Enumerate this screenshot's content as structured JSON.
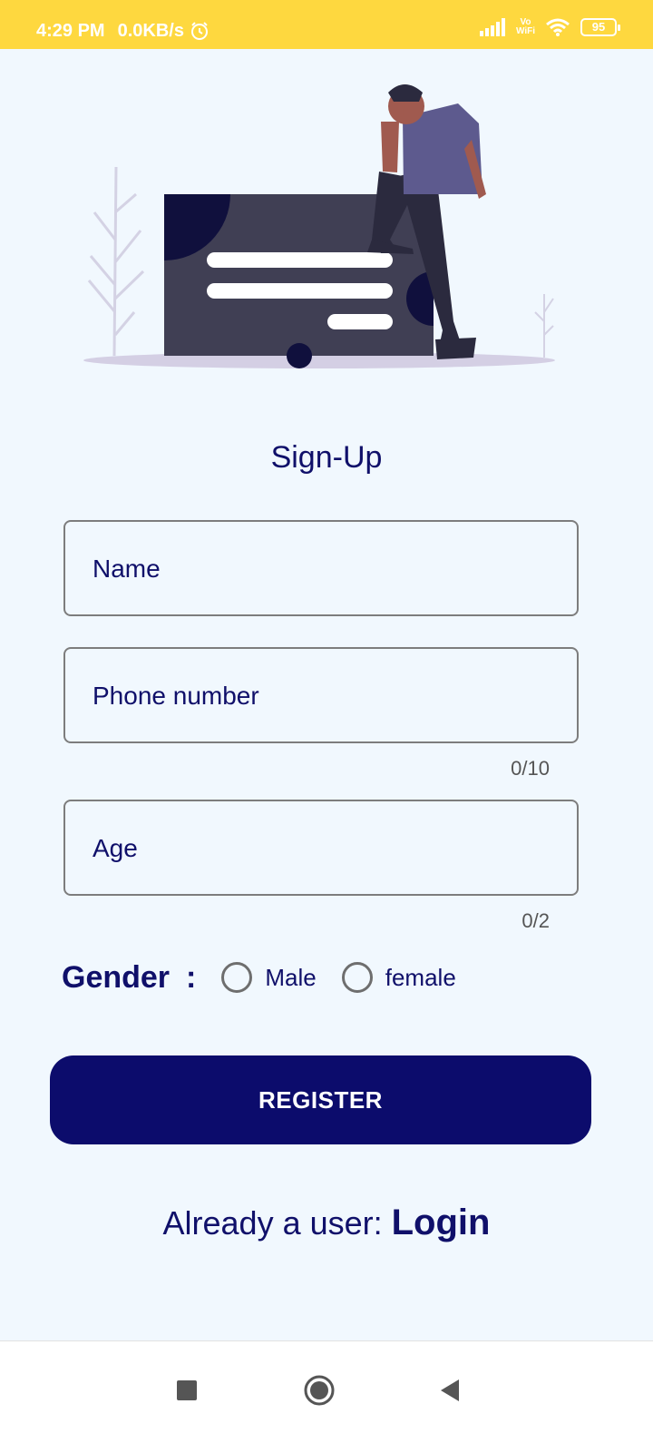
{
  "status_bar": {
    "time": "4:29 PM",
    "speed": "0.0KB/s",
    "battery": "95",
    "vowifi_top": "Vo",
    "vowifi_bottom": "WiFi"
  },
  "form": {
    "title": "Sign-Up",
    "name_placeholder": "Name",
    "phone_placeholder": "Phone number",
    "phone_counter": "0/10",
    "age_placeholder": "Age",
    "age_counter": "0/2",
    "gender_label": "Gender",
    "gender_colon": ":",
    "gender_options": [
      "Male",
      "female"
    ],
    "register_label": "REGISTER",
    "already_user_text": "Already a user: ",
    "login_label": "Login"
  },
  "colors": {
    "status_bar": "#fed83f",
    "background": "#f1f8fe",
    "primary": "#0c0c6c",
    "text": "#10106a"
  },
  "icons": {
    "status": [
      "alarm-icon",
      "signal-icon",
      "vowifi-icon",
      "wifi-icon",
      "battery-icon"
    ],
    "nav": [
      "recents-square-icon",
      "home-circle-icon",
      "back-triangle-icon"
    ]
  }
}
